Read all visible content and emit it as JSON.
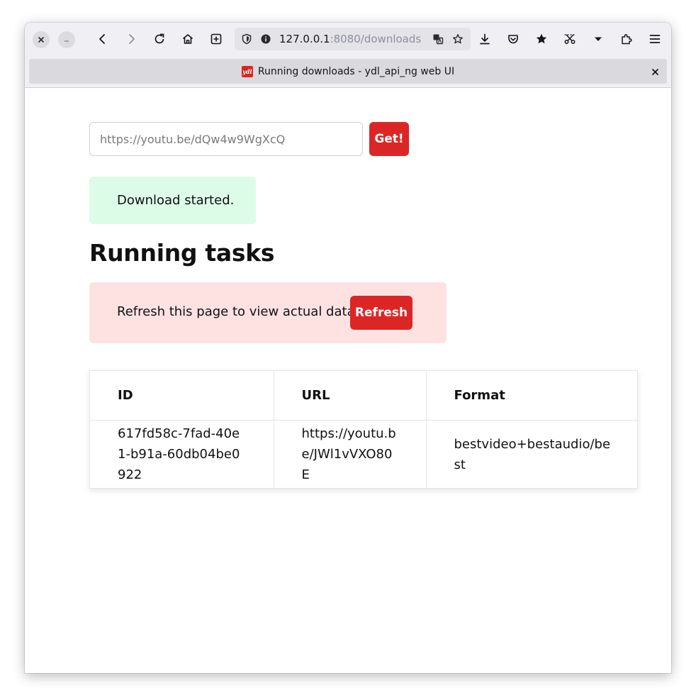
{
  "browser": {
    "url_host": "127.0.0.1",
    "url_rest": ":8080/downloads",
    "tab_title": "Running downloads - ydl_api_ng web UI",
    "favicon_text": "ydl",
    "icons": {
      "close_window": "close-icon",
      "minimize": "minimize-icon",
      "back": "back-arrow-icon",
      "forward": "forward-arrow-icon",
      "reload": "reload-icon",
      "home": "home-icon",
      "new_tab": "new-tab-icon",
      "shield": "shield-icon",
      "info": "info-icon",
      "translate": "translate-icon",
      "bookmark": "star-outline-icon",
      "downloads": "download-icon",
      "pocket": "pocket-icon",
      "bookmarks_star": "star-filled-icon",
      "screenshot": "scissors-icon",
      "overflow": "chevron-down-icon",
      "extensions": "puzzle-icon",
      "menu": "hamburger-menu-icon"
    }
  },
  "form": {
    "placeholder": "https://youtu.be/dQw4w9WgXcQ",
    "submit_label": "Get!"
  },
  "notice_success": "Download started.",
  "section_title": "Running tasks",
  "notice_warning": {
    "text": "Refresh this page to view actual data.",
    "button_label": "Refresh"
  },
  "table": {
    "headers": [
      "ID",
      "URL",
      "Format"
    ],
    "rows": [
      [
        "617fd58c-7fad-40e1-b91a-60db04be0922",
        "https://youtu.be/JWl1vVXO80E",
        "bestvideo+bestaudio/best"
      ]
    ]
  },
  "colors": {
    "accent_red": "#dc2626",
    "success_bg": "#dcfce7",
    "warning_bg": "#fee2e2"
  }
}
